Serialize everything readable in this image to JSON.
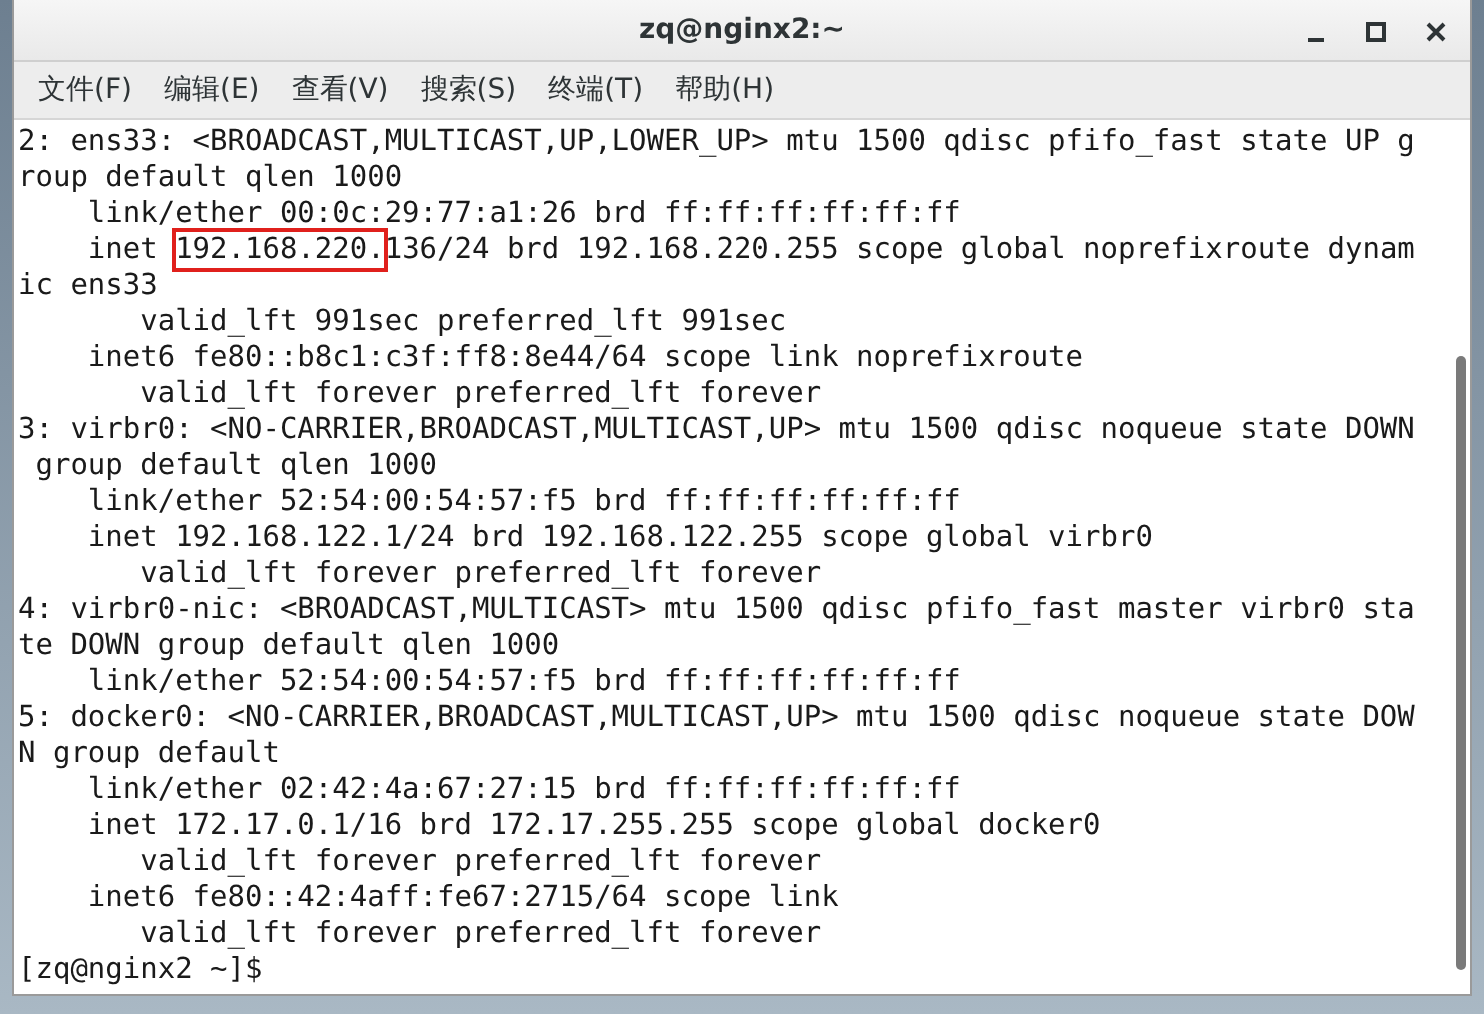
{
  "window": {
    "title": "zq@nginx2:~"
  },
  "menu": [
    "文件(F)",
    "编辑(E)",
    "查看(V)",
    "搜索(S)",
    "终端(T)",
    "帮助(H)"
  ],
  "lines": [
    "2: ens33: <BROADCAST,MULTICAST,UP,LOWER_UP> mtu 1500 qdisc pfifo_fast state UP g",
    "roup default qlen 1000",
    "    link/ether 00:0c:29:77:a1:26 brd ff:ff:ff:ff:ff:ff",
    {
      "parts": [
        {
          "text": "    inet ",
          "highlighted": false
        },
        {
          "text": "192.168.220.",
          "highlighted": true
        },
        {
          "text": "136/24 brd 192.168.220.255 scope global noprefixroute dynam",
          "highlighted": false
        }
      ]
    },
    "ic ens33",
    "       valid_lft 991sec preferred_lft 991sec",
    "    inet6 fe80::b8c1:c3f:ff8:8e44/64 scope link noprefixroute",
    "       valid_lft forever preferred_lft forever",
    "3: virbr0: <NO-CARRIER,BROADCAST,MULTICAST,UP> mtu 1500 qdisc noqueue state DOWN",
    " group default qlen 1000",
    "    link/ether 52:54:00:54:57:f5 brd ff:ff:ff:ff:ff:ff",
    "    inet 192.168.122.1/24 brd 192.168.122.255 scope global virbr0",
    "       valid_lft forever preferred_lft forever",
    "4: virbr0-nic: <BROADCAST,MULTICAST> mtu 1500 qdisc pfifo_fast master virbr0 sta",
    "te DOWN group default qlen 1000",
    "    link/ether 52:54:00:54:57:f5 brd ff:ff:ff:ff:ff:ff",
    "5: docker0: <NO-CARRIER,BROADCAST,MULTICAST,UP> mtu 1500 qdisc noqueue state DOW",
    "N group default",
    "    link/ether 02:42:4a:67:27:15 brd ff:ff:ff:ff:ff:ff",
    "    inet 172.17.0.1/16 brd 172.17.255.255 scope global docker0",
    "       valid_lft forever preferred_lft forever",
    "    inet6 fe80::42:4aff:fe67:2715/64 scope link",
    "       valid_lft forever preferred_lft forever",
    "[zq@nginx2 ~]$"
  ]
}
